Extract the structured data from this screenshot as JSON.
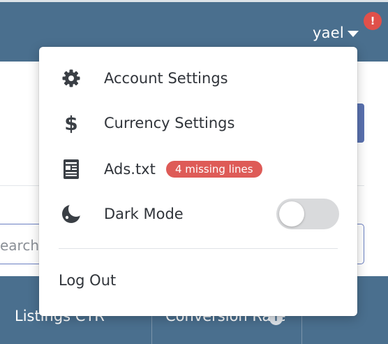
{
  "header": {
    "username": "yael",
    "alert_badge": "!",
    "background_color": "#4a6f8e"
  },
  "background": {
    "search_placeholder": "earch",
    "table_headers": [
      "Listings CTR",
      "Conversion Rate"
    ],
    "info_icon": "i"
  },
  "user_menu": {
    "items": [
      {
        "label": "Account Settings",
        "icon": "gear-icon"
      },
      {
        "label": "Currency Settings",
        "icon": "dollar-icon",
        "icon_text": "$"
      },
      {
        "label": "Ads.txt",
        "icon": "document-icon",
        "badge": "4 missing lines"
      },
      {
        "label": "Dark Mode",
        "icon": "moon-icon",
        "toggle_on": false
      }
    ],
    "logout_label": "Log Out",
    "badge_color": "#de5b57"
  }
}
